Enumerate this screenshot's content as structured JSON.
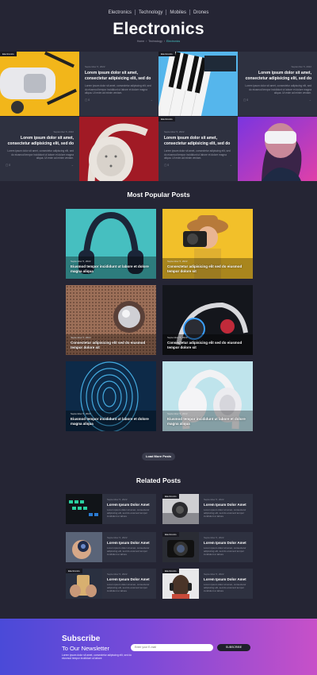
{
  "nav": {
    "items": [
      "Electronics",
      "Technology",
      "Mobiles",
      "Drones"
    ]
  },
  "page_title": "Electronics",
  "breadcrumb": {
    "home": "Home",
    "parent": "Technology",
    "current": "Electronics"
  },
  "featured": {
    "category": "Electronics",
    "date": "September 5, 2022",
    "title": "Lorem ipsum dolor sit amet, consectetur adipisicing elit, sed do",
    "excerpt": "Lorem ipsum dolor sit amet, consectetur adipiscing elit, sed do eiusmod tempor incididunt ut labore et dolore magna aliqua. Ut enim ad minim veniam.",
    "comments": "0",
    "arrow": "→"
  },
  "popular": {
    "heading": "Most Popular Posts",
    "date": "September 5, 2022",
    "posts": [
      {
        "title": "Eiusmod tempor incididunt ut labore et dolore magna aliqua"
      },
      {
        "title": "Consectetur adipisicing elit sed do eiusmod tempor dolore sit"
      },
      {
        "title": "Consectetur adipisicing elit sed do eiusmod tempor dolore sit"
      },
      {
        "title": "Consectetur adipisicing elit sed do eiusmod tempor dolore sit"
      },
      {
        "title": "Eiusmod tempor incididunt ut labore et dolore magna aliqua"
      },
      {
        "title": "Eiusmod tempor incididunt ut labore et dolore magna aliqua"
      }
    ],
    "load_more": "Load More Posts"
  },
  "related": {
    "heading": "Related Posts",
    "date": "September 5, 2022",
    "title": "Lorem Ipsum Dolor Amet",
    "excerpt": "Lorem ipsum dolor sit amet, consectetur adipiscing elit, sed do eiusmod tempor incididunt ut labore",
    "category": "Electronics"
  },
  "subscribe": {
    "title": "Subscribe",
    "subtitle": "To Our Newsletter",
    "text": "Lorem ipsum dolor sit amet, consectetur adipiscing elit, sed do eiusmod tempor incididunt ut labore",
    "placeholder": "Enter your E-mail",
    "button": "SUBSCRIBE"
  },
  "colors": {
    "background": "#252534",
    "card": "#2e3140",
    "accent": "#47c3c3"
  }
}
